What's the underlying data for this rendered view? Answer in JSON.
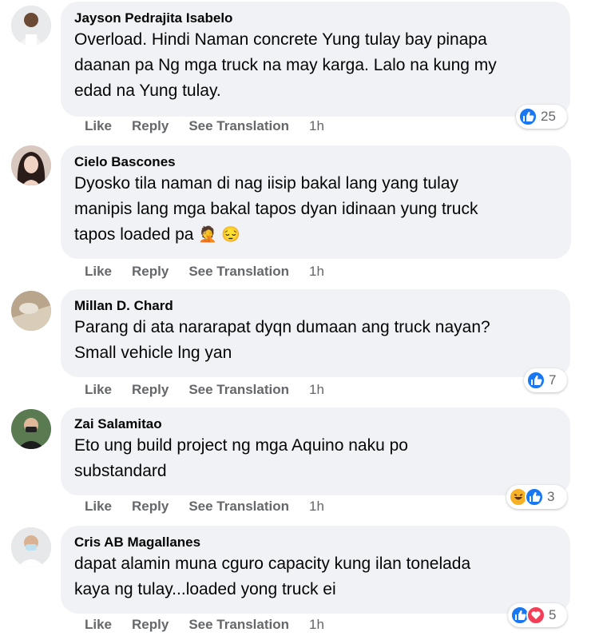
{
  "actions": {
    "like": "Like",
    "reply": "Reply",
    "see_translation": "See Translation"
  },
  "colors": {
    "bubble": "#f0f2f5",
    "like_blue": "#1877f2",
    "haha_yellow": "#f7b125",
    "love_red": "#f33e58",
    "action_gray": "#65676b"
  },
  "comments": [
    {
      "author": "Jayson Pedrajita Isabelo",
      "text": "Overload. Hindi Naman concrete Yung tulay bay pinapa\ndaanan pa Ng mga truck na may karga. Lalo na kung my\nedad na Yung tulay.",
      "time": "1h",
      "reaction_count": "25",
      "reactions": [
        "like-icon"
      ]
    },
    {
      "author": "Cielo Bascones",
      "text": "Dyosko tila naman di nag iisip bakal lang yang tulay\nmanipis lang mga bakal tapos dyan idinaan yung truck\ntapos loaded pa",
      "emoji": "🤦 😔",
      "time": "1h",
      "reaction_count": "",
      "reactions": []
    },
    {
      "author": "Millan D. Chard",
      "text": "Parang di ata nararapat dyqn dumaan ang truck nayan?\nSmall vehicle lng yan",
      "time": "1h",
      "reaction_count": "7",
      "reactions": [
        "like-icon"
      ]
    },
    {
      "author": "Zai Salamitao",
      "text": "Eto ung build project ng mga Aquino naku po\nsubstandard",
      "time": "1h",
      "reaction_count": "3",
      "reactions": [
        "haha-icon",
        "like-icon"
      ]
    },
    {
      "author": "Cris AB Magallanes",
      "text": "dapat alamin muna cguro capacity kung ilan tonelada\nkaya ng tulay...loaded yong truck ei",
      "time": "1h",
      "reaction_count": "5",
      "reactions": [
        "like-icon",
        "love-icon"
      ]
    }
  ]
}
